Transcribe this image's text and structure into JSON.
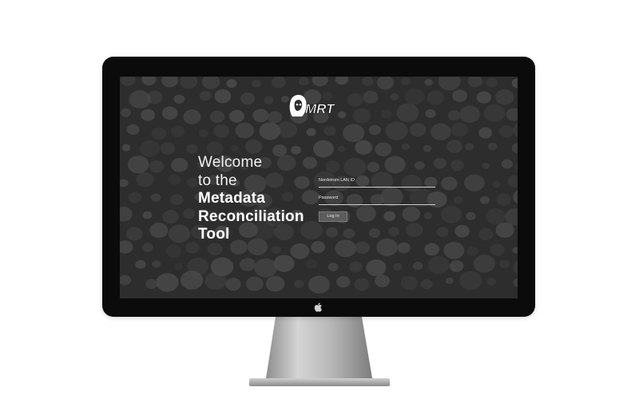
{
  "app": {
    "logo_text": "MRT"
  },
  "welcome": {
    "line1": "Welcome",
    "line2": "to the",
    "line3": "Metadata",
    "line4": "Reconciliation",
    "line5": "Tool"
  },
  "form": {
    "lan_id_label": "Nordstrom LAN ID",
    "password_label": "Password",
    "login_button": "Log In"
  },
  "colors": {
    "screen_background": "#2d2d2d",
    "dot_color": "#555555",
    "bezel": "#0b0b0b"
  },
  "icons": {
    "logo_mark": "hooded-figure-logo",
    "hardware": "apple-icon"
  }
}
